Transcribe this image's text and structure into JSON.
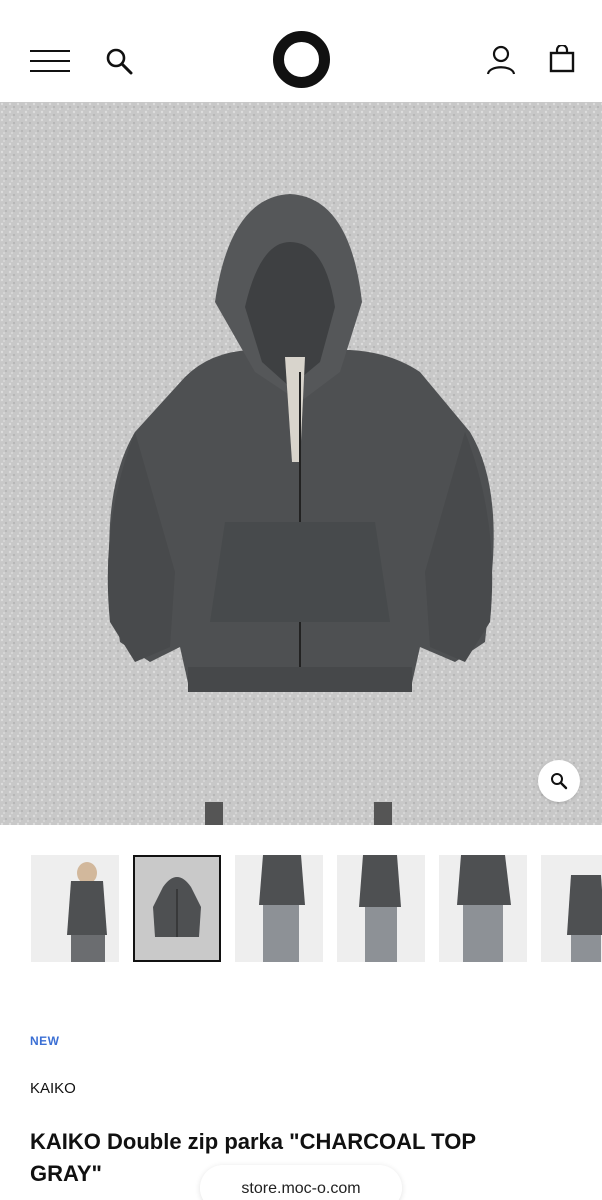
{
  "header": {
    "menu_icon": "hamburger-menu-icon",
    "search_icon": "search-icon",
    "logo_icon": "ring-logo",
    "account_icon": "user-icon",
    "cart_icon": "shopping-bag-icon"
  },
  "gallery": {
    "main_image": "charcoal zip parka laid flat on gray shag rug",
    "zoom_icon": "magnifier-icon",
    "thumbnails": [
      {
        "selected": false
      },
      {
        "selected": true
      },
      {
        "selected": false
      },
      {
        "selected": false
      },
      {
        "selected": false
      },
      {
        "selected": false
      }
    ]
  },
  "product": {
    "badge": "NEW",
    "brand": "KAIKO",
    "title": "KAIKO Double zip parka \"CHARCOAL TOP GRAY\""
  },
  "browser": {
    "url": "store.moc-o.com"
  },
  "colors": {
    "badge_blue": "#3b6fd4",
    "text": "#111111",
    "parka": "#4e5052",
    "rug": "#c9c9c9"
  }
}
